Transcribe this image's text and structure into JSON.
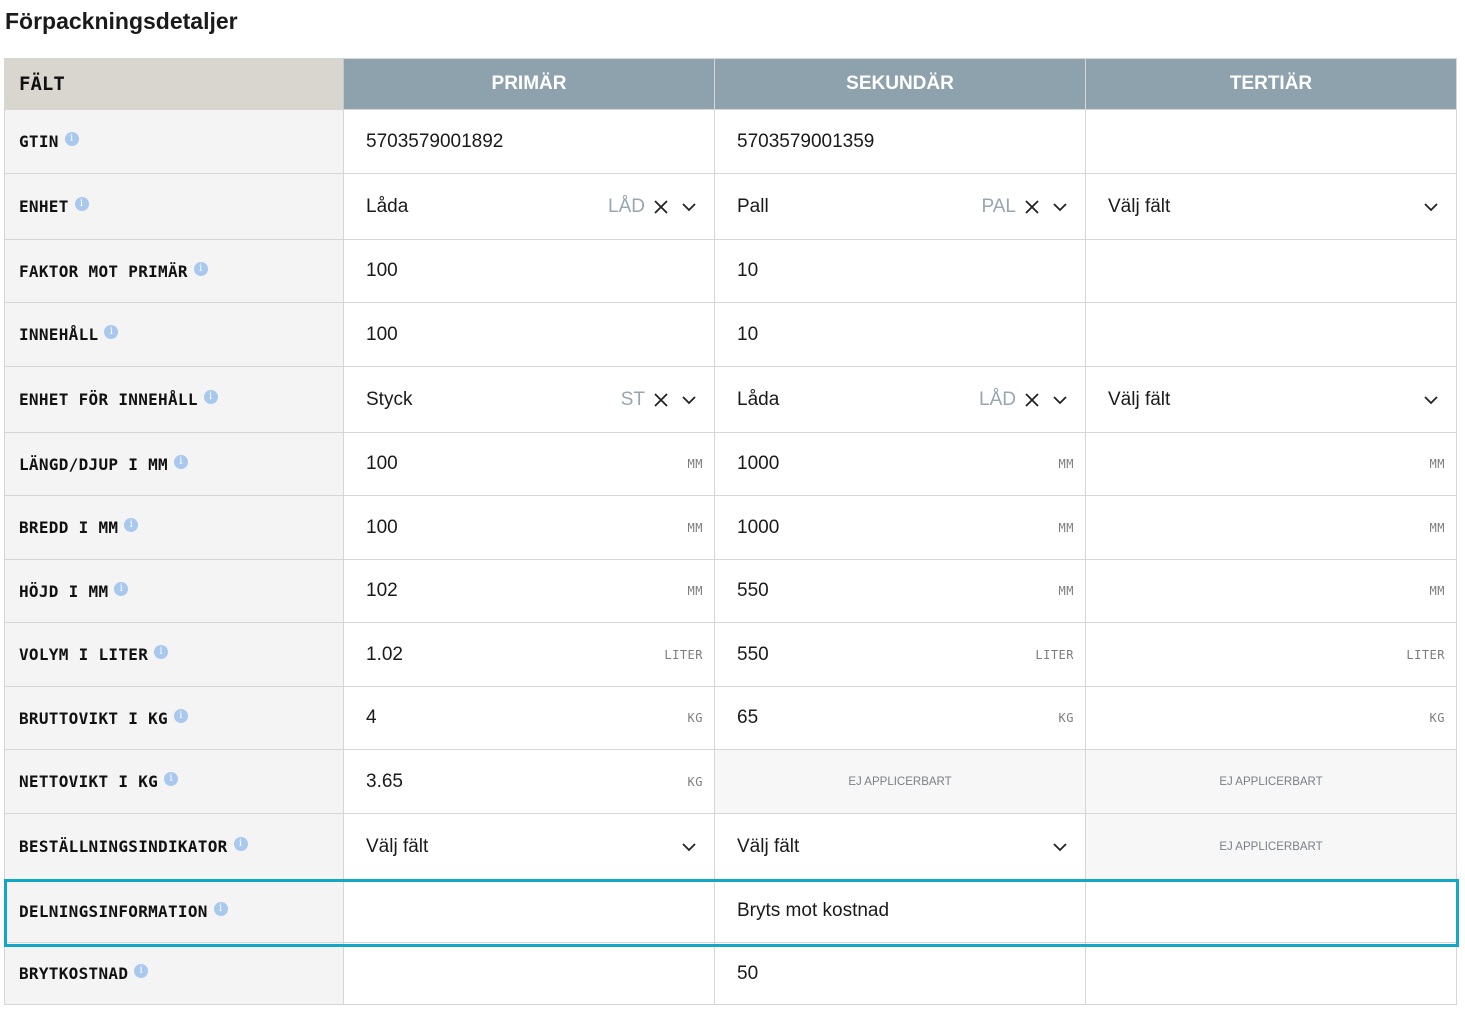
{
  "page": {
    "title": "Förpackningsdetaljer"
  },
  "header": {
    "field": "FÄLT",
    "primary": "PRIMÄR",
    "secondary": "SEKUNDÄR",
    "tertiary": "TERTIÄR"
  },
  "rows": {
    "gtin": {
      "label": "GTIN",
      "primary": "5703579001892",
      "secondary": "5703579001359",
      "tertiary": ""
    },
    "unit": {
      "label": "ENHET",
      "primary": {
        "value": "Låda",
        "code": "LÅD"
      },
      "secondary": {
        "value": "Pall",
        "code": "PAL"
      },
      "tertiary": {
        "placeholder": "Välj fält"
      }
    },
    "factor": {
      "label": "FAKTOR MOT PRIMÄR",
      "primary": "100",
      "secondary": "10",
      "tertiary": ""
    },
    "content": {
      "label": "INNEHÅLL",
      "primary": "100",
      "secondary": "10",
      "tertiary": ""
    },
    "content_unit": {
      "label": "ENHET FÖR INNEHÅLL",
      "primary": {
        "value": "Styck",
        "code": "ST"
      },
      "secondary": {
        "value": "Låda",
        "code": "LÅD"
      },
      "tertiary": {
        "placeholder": "Välj fält"
      }
    },
    "length": {
      "label": "LÄNGD/DJUP I MM",
      "unit": "MM",
      "primary": "100",
      "secondary": "1000",
      "tertiary": ""
    },
    "width": {
      "label": "BREDD I MM",
      "unit": "MM",
      "primary": "100",
      "secondary": "1000",
      "tertiary": ""
    },
    "height": {
      "label": "HÖJD I MM",
      "unit": "MM",
      "primary": "102",
      "secondary": "550",
      "tertiary": ""
    },
    "volume": {
      "label": "VOLYM I LITER",
      "unit": "LITER",
      "primary": "1.02",
      "secondary": "550",
      "tertiary": ""
    },
    "gross_weight": {
      "label": "BRUTTOVIKT I KG",
      "unit": "KG",
      "primary": "4",
      "secondary": "65",
      "tertiary": ""
    },
    "net_weight": {
      "label": "NETTOVIKT I KG",
      "unit": "KG",
      "primary": "3.65",
      "secondary_na": "EJ APPLICERBART",
      "tertiary_na": "EJ APPLICERBART"
    },
    "order_indicator": {
      "label": "BESTÄLLNINGSINDIKATOR",
      "primary": {
        "placeholder": "Välj fält"
      },
      "secondary": {
        "placeholder": "Välj fält"
      },
      "tertiary_na": "EJ APPLICERBART"
    },
    "split_info": {
      "label": "DELNINGSINFORMATION",
      "primary": "",
      "secondary": "Bryts mot kostnad",
      "tertiary": ""
    },
    "break_cost": {
      "label": "BRYTKOSTNAD",
      "primary": "",
      "secondary": "50",
      "tertiary": ""
    }
  },
  "icons": {
    "info": "info-icon",
    "clear": "close-icon",
    "dropdown": "chevron-down-icon"
  },
  "colors": {
    "header_bg": "#8ea2ae",
    "field_header_bg": "#d9d6d0",
    "highlight": "#12a7c6",
    "info_icon": "#a9c8ee"
  }
}
